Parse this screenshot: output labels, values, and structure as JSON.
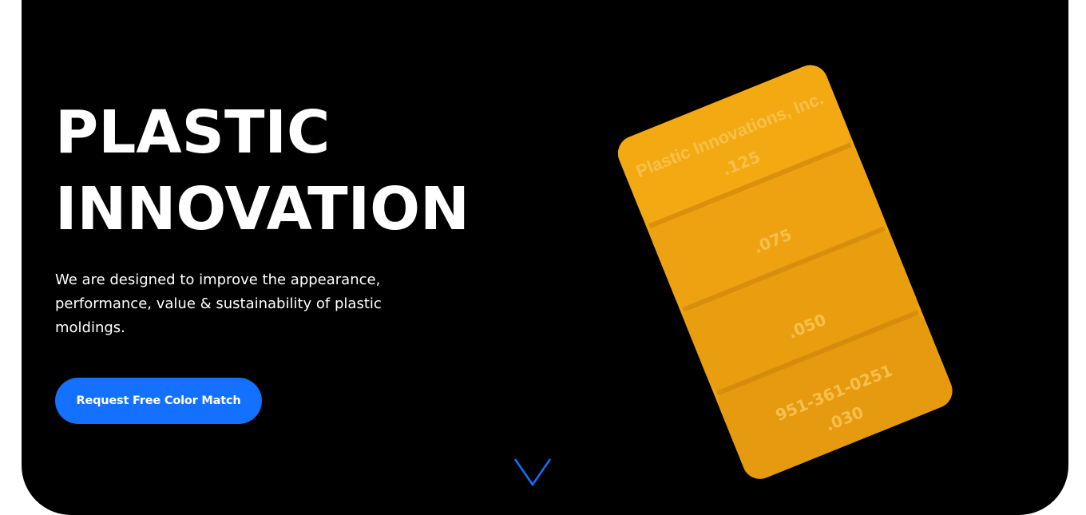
{
  "hero": {
    "headline_line1": "PLASTIC",
    "headline_line2": "INNOVATION",
    "description": "We are designed to improve the appearance, performance, value & sustainability of plastic moldings.",
    "cta_label": "Request Free Color Match",
    "scroll_icon": "chevron-down-icon"
  },
  "product_image": {
    "icon": "color-chip-sample",
    "brand_text": "Plastic Innovations, Inc.",
    "step_labels": [
      ".125",
      ".075",
      ".050",
      ".030"
    ],
    "phone_text": "951-361-0251",
    "color": "#f2a30f"
  },
  "colors": {
    "background": "#000000",
    "accent": "#1470ff",
    "text": "#ffffff"
  }
}
